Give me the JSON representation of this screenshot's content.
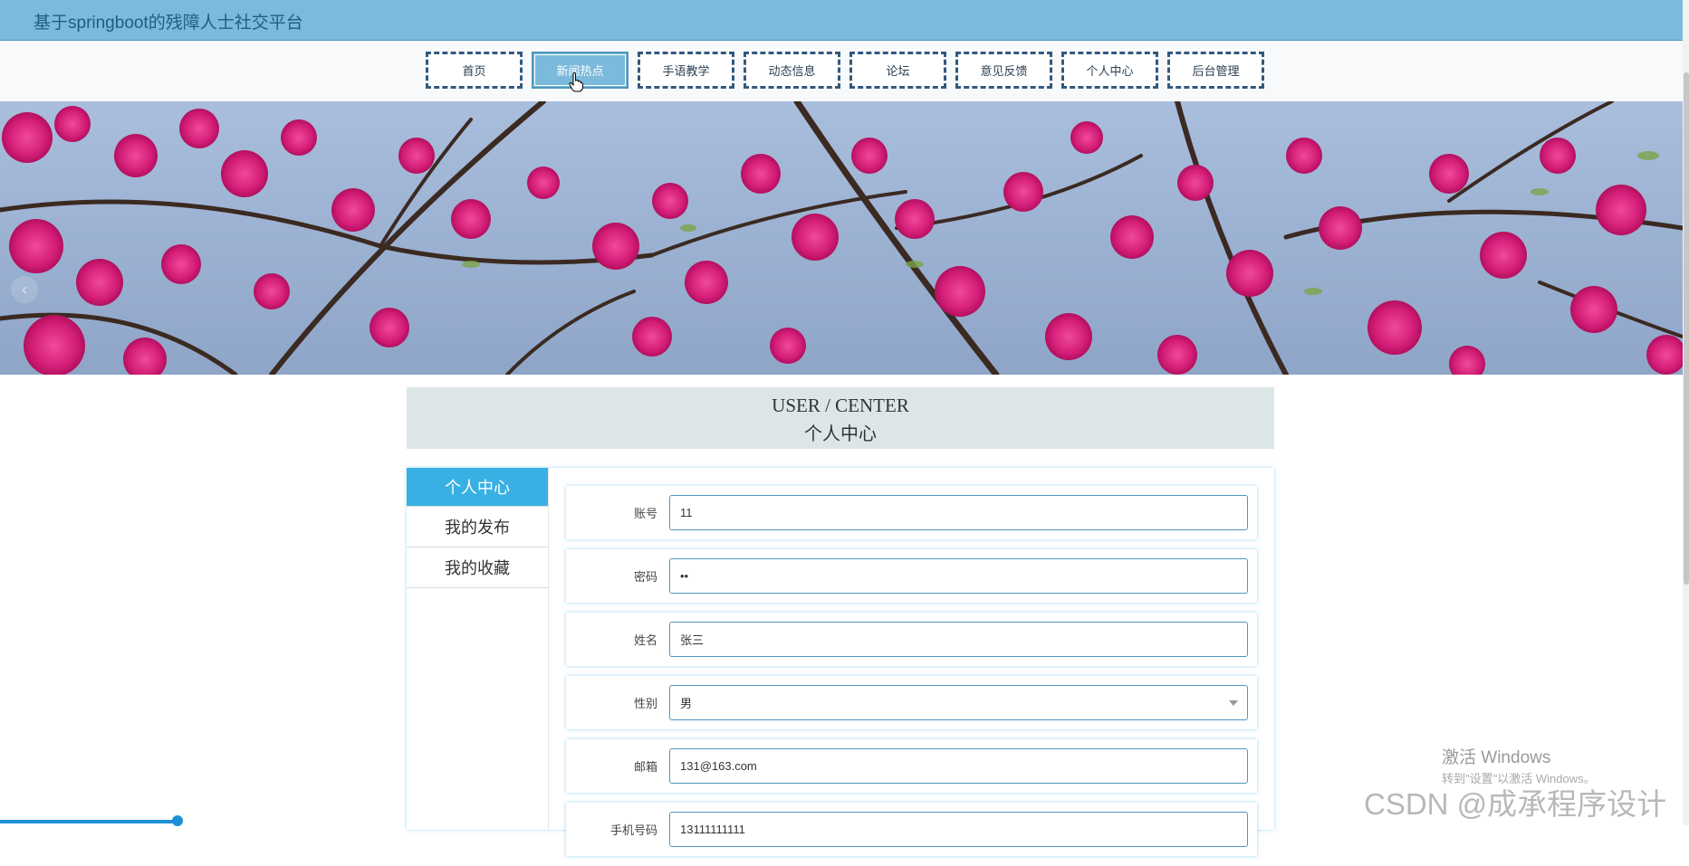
{
  "header": {
    "site_title": "基于springboot的残障人士社交平台"
  },
  "nav": {
    "items": [
      {
        "label": "首页"
      },
      {
        "label": "新闻热点"
      },
      {
        "label": "手语教学"
      },
      {
        "label": "动态信息"
      },
      {
        "label": "论坛"
      },
      {
        "label": "意见反馈"
      },
      {
        "label": "个人中心"
      },
      {
        "label": "后台管理"
      }
    ],
    "active_index": 1
  },
  "banner": {
    "prev_icon": "chevron-left-icon",
    "slide_count": 3,
    "active_slide": 1
  },
  "section": {
    "title_en": "USER / CENTER",
    "title_cn": "个人中心"
  },
  "sidebar": {
    "items": [
      {
        "label": "个人中心"
      },
      {
        "label": "我的发布"
      },
      {
        "label": "我的收藏"
      }
    ],
    "active_index": 0
  },
  "form": {
    "fields": [
      {
        "label": "账号",
        "value": "11"
      },
      {
        "label": "密码",
        "value": "••"
      },
      {
        "label": "姓名",
        "value": "张三"
      },
      {
        "label": "性别",
        "value": "男"
      },
      {
        "label": "邮箱",
        "value": "131@163.com"
      },
      {
        "label": "手机号码",
        "value": "13111111111"
      }
    ]
  },
  "overlay": {
    "activate_title": "激活 Windows",
    "activate_sub": "转到\"设置\"以激活 Windows。",
    "csdn": "CSDN @成承程序设计"
  },
  "colors": {
    "header": "#7bbada",
    "accent": "#38b0e3",
    "nav_border": "#32597e"
  }
}
